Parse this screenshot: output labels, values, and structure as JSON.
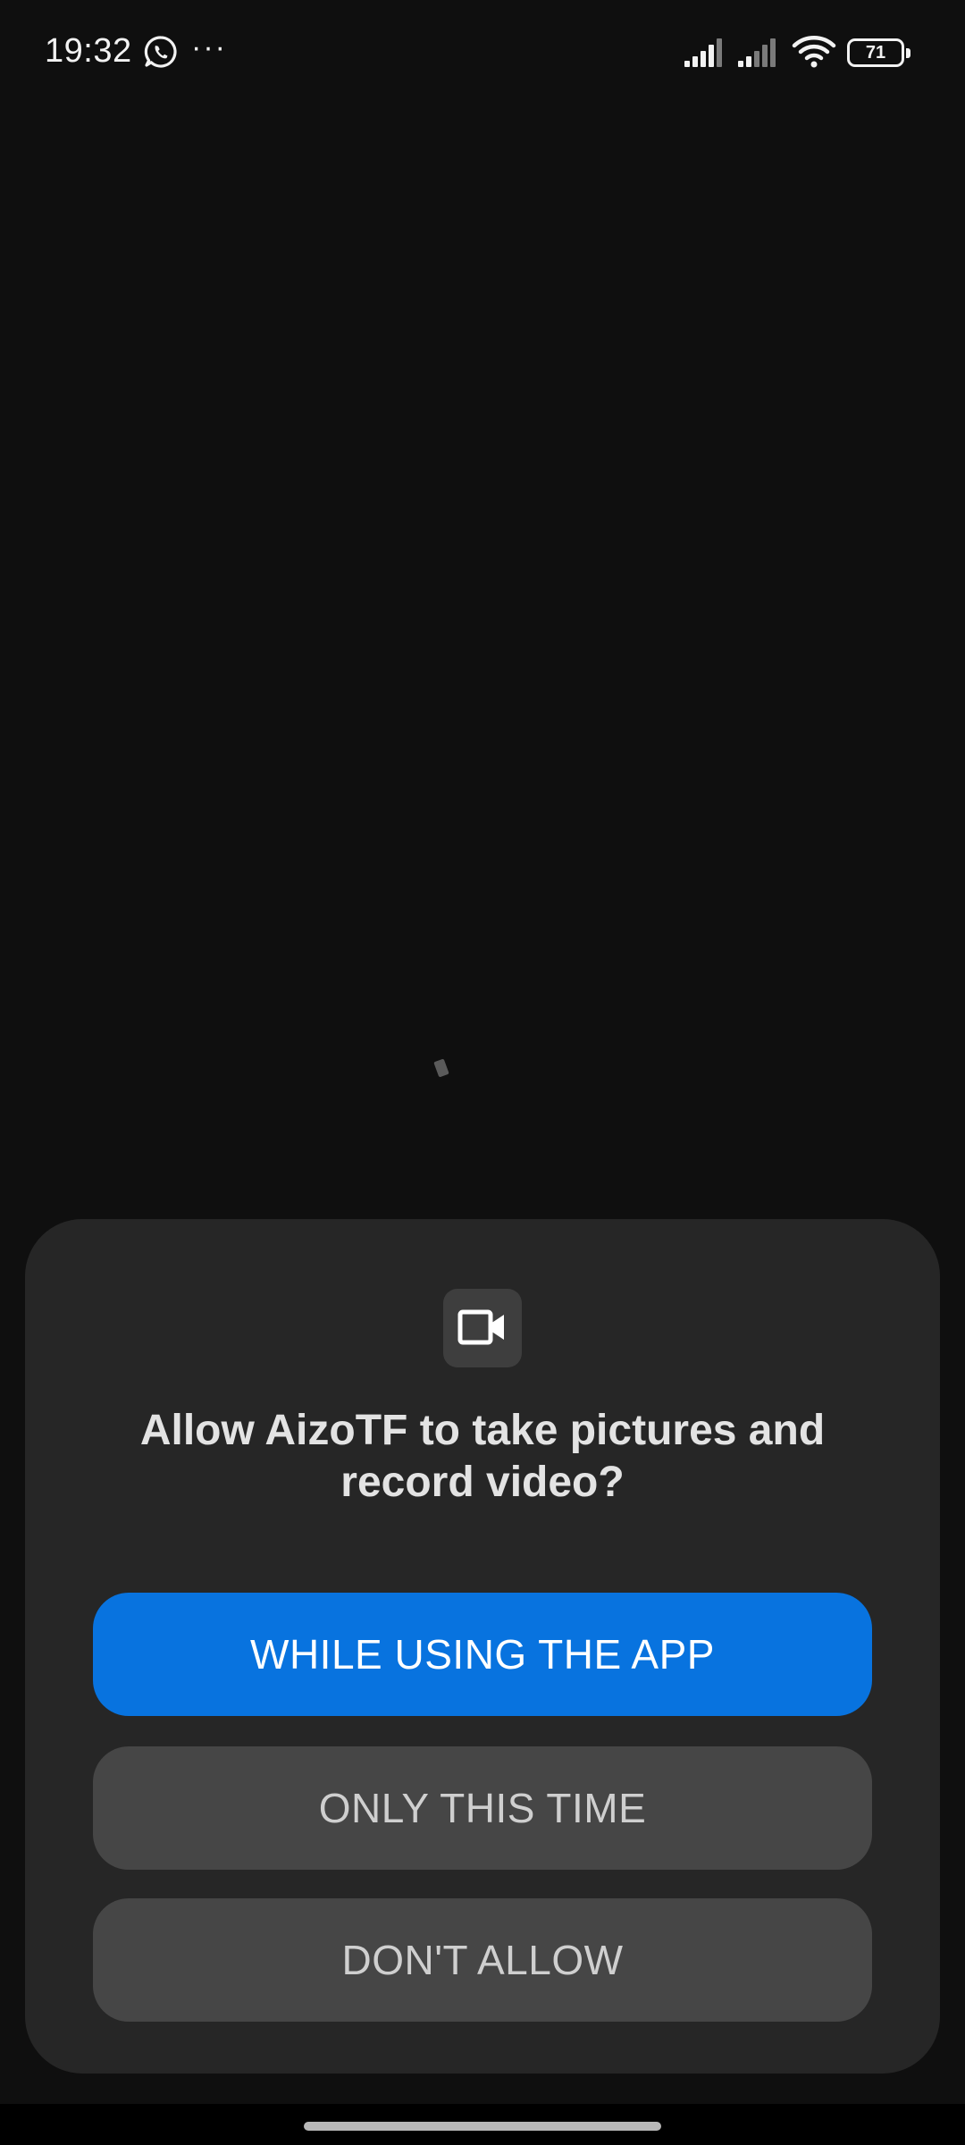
{
  "status_bar": {
    "time": "19:32",
    "more_indicator": "···",
    "battery_level": "71",
    "icons": [
      "whatsapp-icon",
      "signal-icon",
      "signal-icon",
      "wifi-icon",
      "battery-icon"
    ]
  },
  "dialog": {
    "icon": "video-camera-icon",
    "title": "Allow AizoTF to take pictures and record video?",
    "buttons": {
      "while_using": "WHILE USING THE APP",
      "only_this_time": "ONLY THIS TIME",
      "dont_allow": "DON'T ALLOW"
    }
  },
  "colors": {
    "background": "#0f0f0f",
    "dialog_background": "#262626",
    "primary_button": "#0873df",
    "secondary_button": "#464646"
  }
}
